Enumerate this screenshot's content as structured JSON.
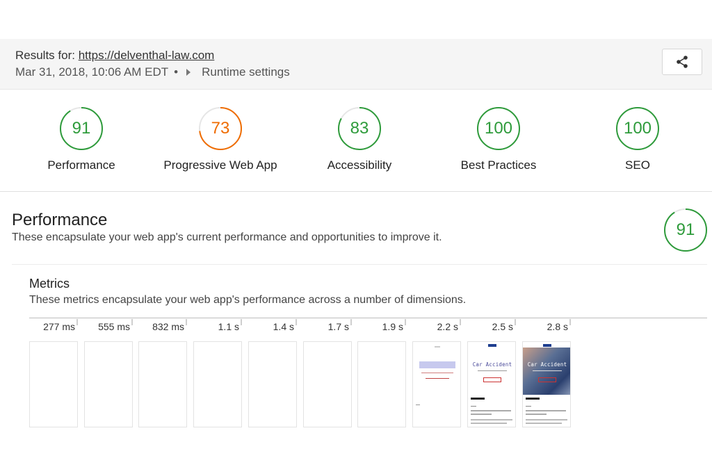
{
  "header": {
    "results_prefix": "Results for:",
    "url": "https://delventhal-law.com",
    "date": "Mar 31, 2018, 10:06 AM EDT",
    "separator": "•",
    "runtime_settings": "Runtime settings",
    "share_icon": "share-icon"
  },
  "categories": [
    {
      "label": "Performance",
      "score": "91",
      "color": "#2e9b3b",
      "fraction": 0.91
    },
    {
      "label": "Progressive Web App",
      "score": "73",
      "color": "#ef6c00",
      "fraction": 0.73
    },
    {
      "label": "Accessibility",
      "score": "83",
      "color": "#2e9b3b",
      "fraction": 0.83
    },
    {
      "label": "Best Practices",
      "score": "100",
      "color": "#2e9b3b",
      "fraction": 1.0
    },
    {
      "label": "SEO",
      "score": "100",
      "color": "#2e9b3b",
      "fraction": 1.0
    }
  ],
  "performance": {
    "title": "Performance",
    "description": "These encapsulate your web app's current performance and opportunities to improve it.",
    "score": "91",
    "fraction": 0.91,
    "color": "#2e9b3b"
  },
  "metrics": {
    "title": "Metrics",
    "description": "These metrics encapsulate your web app's performance across a number of dimensions.",
    "frames": [
      {
        "time": "277 ms"
      },
      {
        "time": "555 ms"
      },
      {
        "time": "832 ms"
      },
      {
        "time": "1.1 s"
      },
      {
        "time": "1.4 s"
      },
      {
        "time": "1.7 s"
      },
      {
        "time": "1.9 s"
      },
      {
        "time": "2.2 s"
      },
      {
        "time": "2.5 s",
        "heading": "Car Accident"
      },
      {
        "time": "2.8 s",
        "heading": "Car Accident"
      }
    ]
  }
}
